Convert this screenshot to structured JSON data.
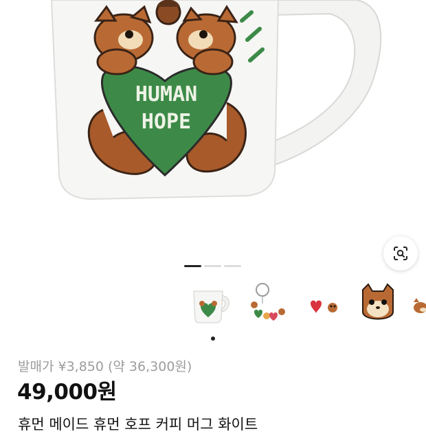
{
  "product": {
    "release_price": "발매가 ¥3,850 (약 36,300원)",
    "price": "49,000원",
    "title": "휴먼 메이드 휴먼 호프 커피 머그 화이트"
  },
  "hero": {
    "mug_print_text_line1": "HUMAN",
    "mug_print_text_line2": "HOPE",
    "mug_color": "#f6f6f4",
    "heart_color": "#3d8a48"
  },
  "gallery": {
    "pages": 3,
    "active_page": 1,
    "thumbnails": [
      "mug",
      "keychain",
      "stickers",
      "squirrel-patch",
      "squirrel-partial"
    ]
  },
  "icons": {
    "lens": "visual-search-icon"
  }
}
